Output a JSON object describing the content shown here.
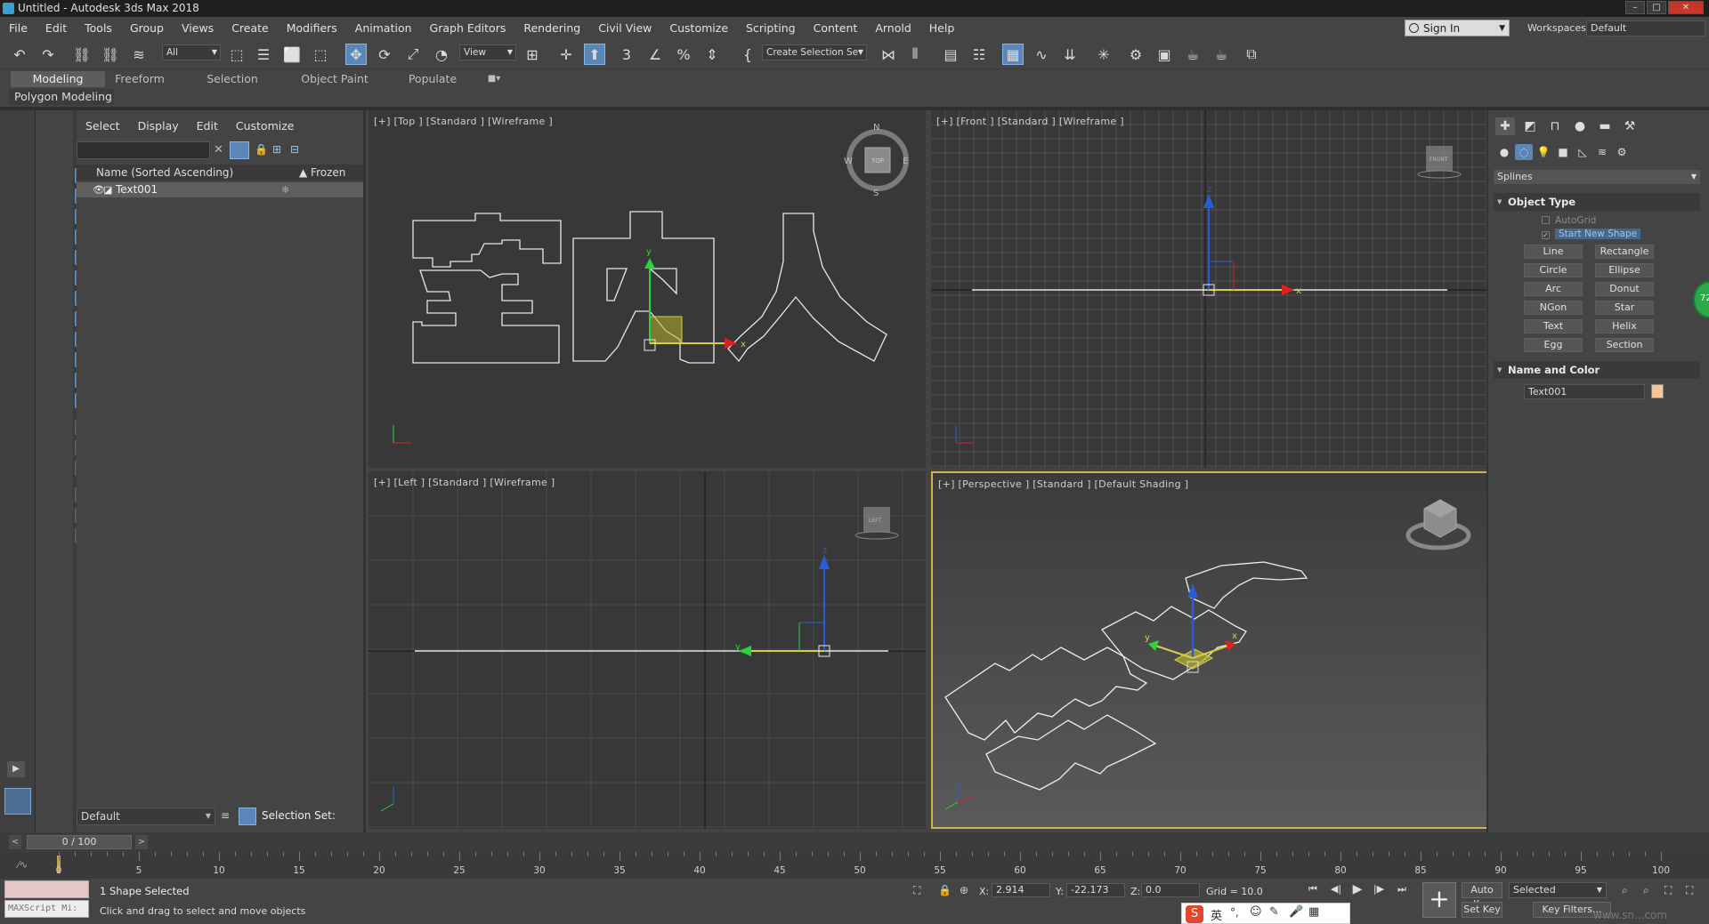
{
  "window": {
    "title": "Untitled - Autodesk 3ds Max 2018"
  },
  "menu": [
    "File",
    "Edit",
    "Tools",
    "Group",
    "Views",
    "Create",
    "Modifiers",
    "Animation",
    "Graph Editors",
    "Rendering",
    "Civil View",
    "Customize",
    "Scripting",
    "Content",
    "Arnold",
    "Help"
  ],
  "account": {
    "sign_in": "Sign In",
    "workspaces_label": "Workspaces:",
    "workspace": "Default"
  },
  "toolbar": {
    "filter": "All",
    "ref_coord": "View",
    "selection_set": "Create Selection Se"
  },
  "ribbon": {
    "tabs": [
      "Modeling",
      "Freeform",
      "Selection",
      "Object Paint",
      "Populate"
    ],
    "active": "Modeling",
    "sub": "Polygon Modeling"
  },
  "scene_explorer": {
    "menu": [
      "Select",
      "Display",
      "Edit",
      "Customize"
    ],
    "col_name": "Name (Sorted Ascending)",
    "col_frozen": "▲ Frozen",
    "rows": [
      "Text001"
    ],
    "layer": "Default",
    "selection_set_label": "Selection Set:"
  },
  "viewports": {
    "top": "[+] [Top ] [Standard ] [Wireframe ]",
    "front": "[+] [Front ] [Standard ] [Wireframe ]",
    "left": "[+] [Left ] [Standard ] [Wireframe ]",
    "perspective": "[+] [Perspective ] [Standard ] [Default Shading ]",
    "text_shape": "室内人",
    "viewcube": {
      "top": "TOP",
      "front": "FRONT",
      "left": "LEFT",
      "n": "N",
      "s": "S",
      "e": "E",
      "w": "W"
    }
  },
  "command_panel": {
    "category": "Splines",
    "object_type_title": "Object Type",
    "autogrid": "AutoGrid",
    "start_new_shape": "Start New Shape",
    "buttons": [
      "Line",
      "Rectangle",
      "Circle",
      "Ellipse",
      "Arc",
      "Donut",
      "NGon",
      "Star",
      "Text",
      "Helix",
      "Egg",
      "Section"
    ],
    "name_color_title": "Name and Color",
    "object_name": "Text001",
    "object_color": "#f5c49a",
    "badge": "72"
  },
  "time_slider": {
    "value": "0 / 100",
    "ticks": [
      0,
      5,
      10,
      15,
      20,
      25,
      30,
      35,
      40,
      45,
      50,
      55,
      60,
      65,
      70,
      75,
      80,
      85,
      90,
      95,
      100
    ]
  },
  "status": {
    "maxscript": "MAXScript Mi:",
    "selected": "1 Shape Selected",
    "prompt": "Click and drag to select and move objects",
    "x": "2.914",
    "y": "-22.173",
    "z": "0.0",
    "grid": "Grid = 10.0",
    "auto_key": "Auto Key",
    "set_key": "Set Key",
    "key_mode": "Selected",
    "key_filters": "Key Filters..."
  },
  "ime": {
    "lang": "英"
  },
  "watermark": "www.sn...com"
}
